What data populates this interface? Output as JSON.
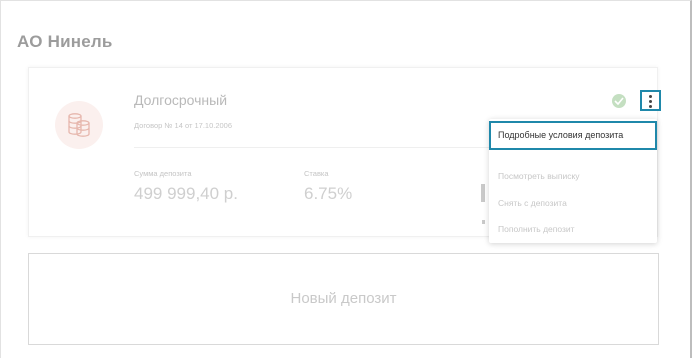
{
  "company": {
    "title": "АО Нинель"
  },
  "deposit": {
    "name": "Долгосрочный",
    "contract": "Договор № 14 от 17.10.2006",
    "amount_label": "Сумма депозита",
    "amount_value": "499 999,40 р.",
    "rate_label": "Ставка",
    "rate_value": "6.75%",
    "icon": "coins-icon",
    "status_icon": "check-circle-icon",
    "status_color": "#c4dfc1"
  },
  "menu": {
    "button_icon": "kebab-menu-icon",
    "accent_color": "#1f88aa",
    "items": [
      {
        "label": "Подробные условия депозита"
      },
      {
        "label": "Посмотреть выписку"
      },
      {
        "label": "Снять с депозита"
      },
      {
        "label": "Пополнить депозит"
      }
    ]
  },
  "new_deposit": {
    "label": "Новый депозит"
  }
}
